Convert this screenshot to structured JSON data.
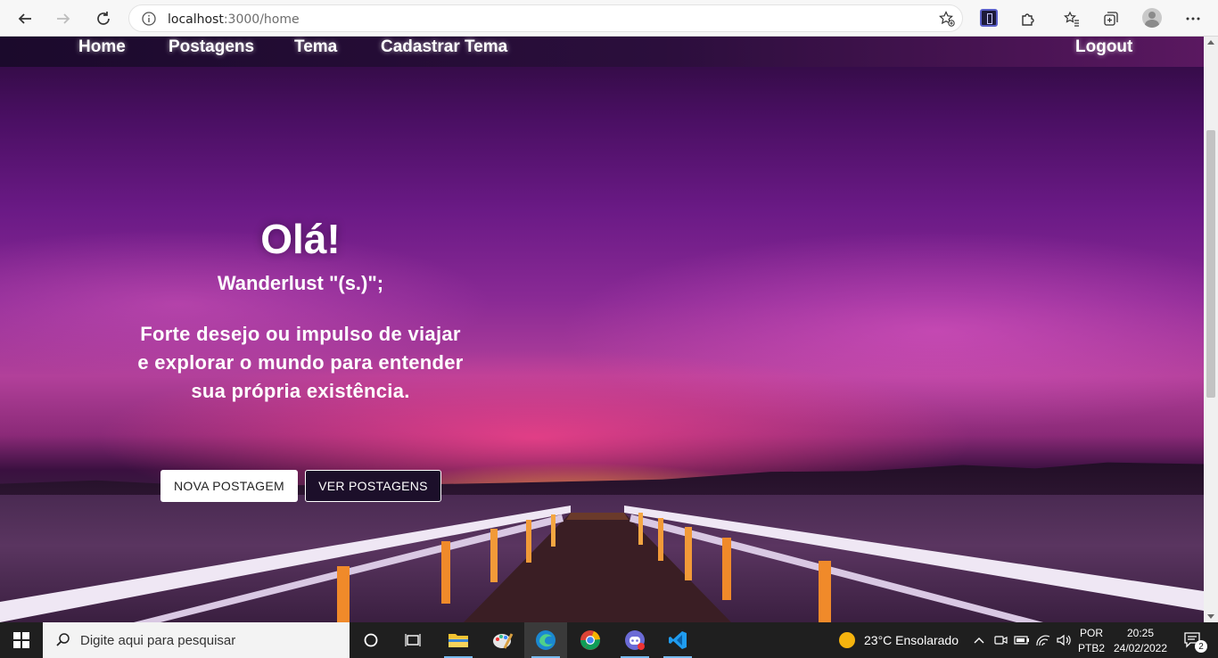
{
  "browser": {
    "url_host": "localhost",
    "url_path": ":3000/home"
  },
  "nav": {
    "home": "Home",
    "posts": "Postagens",
    "theme": "Tema",
    "register_theme": "Cadastrar Tema",
    "logout": "Logout"
  },
  "hero": {
    "title": "Olá!",
    "word": "Wanderlust \"(s.)\";",
    "description": "Forte desejo ou impulso de viajar e explorar o mundo para entender sua própria existência."
  },
  "buttons": {
    "new_post": "NOVA POSTAGEM",
    "view_posts": "VER POSTAGENS"
  },
  "taskbar": {
    "search_placeholder": "Digite aqui para pesquisar",
    "weather": "23°C  Ensolarado",
    "lang_top": "POR",
    "lang_bottom": "PTB2",
    "time": "20:25",
    "date": "24/02/2022",
    "notifications": "2"
  },
  "colors": {
    "navbar": "#2b0e3c",
    "sky_accent": "#b2409a",
    "button_outline_bg": "#1c0f2a"
  }
}
